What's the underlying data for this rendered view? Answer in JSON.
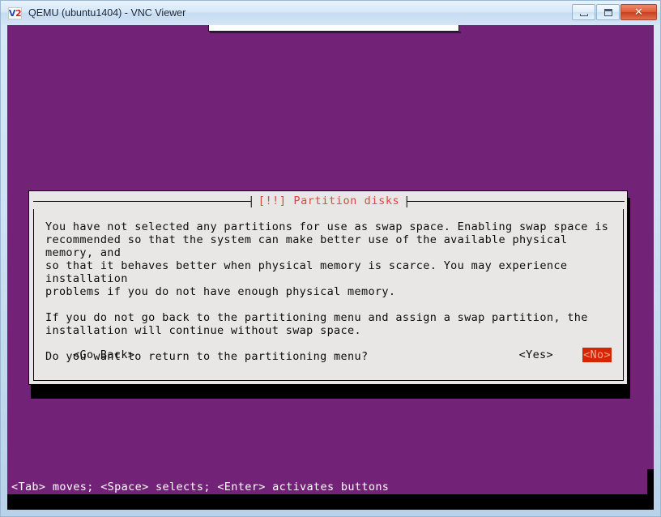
{
  "window": {
    "title": "QEMU (ubuntu1404) - VNC Viewer",
    "logo_primary": "V",
    "logo_secondary": "2",
    "logo_icon": "vnc-viewer-logo",
    "controls": {
      "minimize_label": "",
      "maximize_label": "",
      "close_label": "✕"
    },
    "frame_color": "#b9d3e8",
    "titlebar_color": "#d7e8f7"
  },
  "remote_screen": {
    "background_color": "#722277",
    "status_line": "<Tab> moves; <Space> selects; <Enter> activates buttons"
  },
  "dialog": {
    "title": "[!!] Partition disks",
    "title_color": "#d64a43",
    "background_color": "#e9e6e6",
    "paragraphs": [
      "You have not selected any partitions for use as swap space. Enabling swap space is\nrecommended so that the system can make better use of the available physical memory, and\nso that it behaves better when physical memory is scarce. You may experience installation\nproblems if you do not have enough physical memory.",
      "If you do not go back to the partitioning menu and assign a swap partition, the\ninstallation will continue without swap space.",
      "Do you want to return to the partitioning menu?"
    ],
    "buttons": {
      "go_back": "<Go Back>",
      "yes": "<Yes>",
      "no": "<No>",
      "selected": "<No>",
      "selected_bg_color": "#d62600",
      "selected_fg_color": "#f5a79b"
    }
  }
}
